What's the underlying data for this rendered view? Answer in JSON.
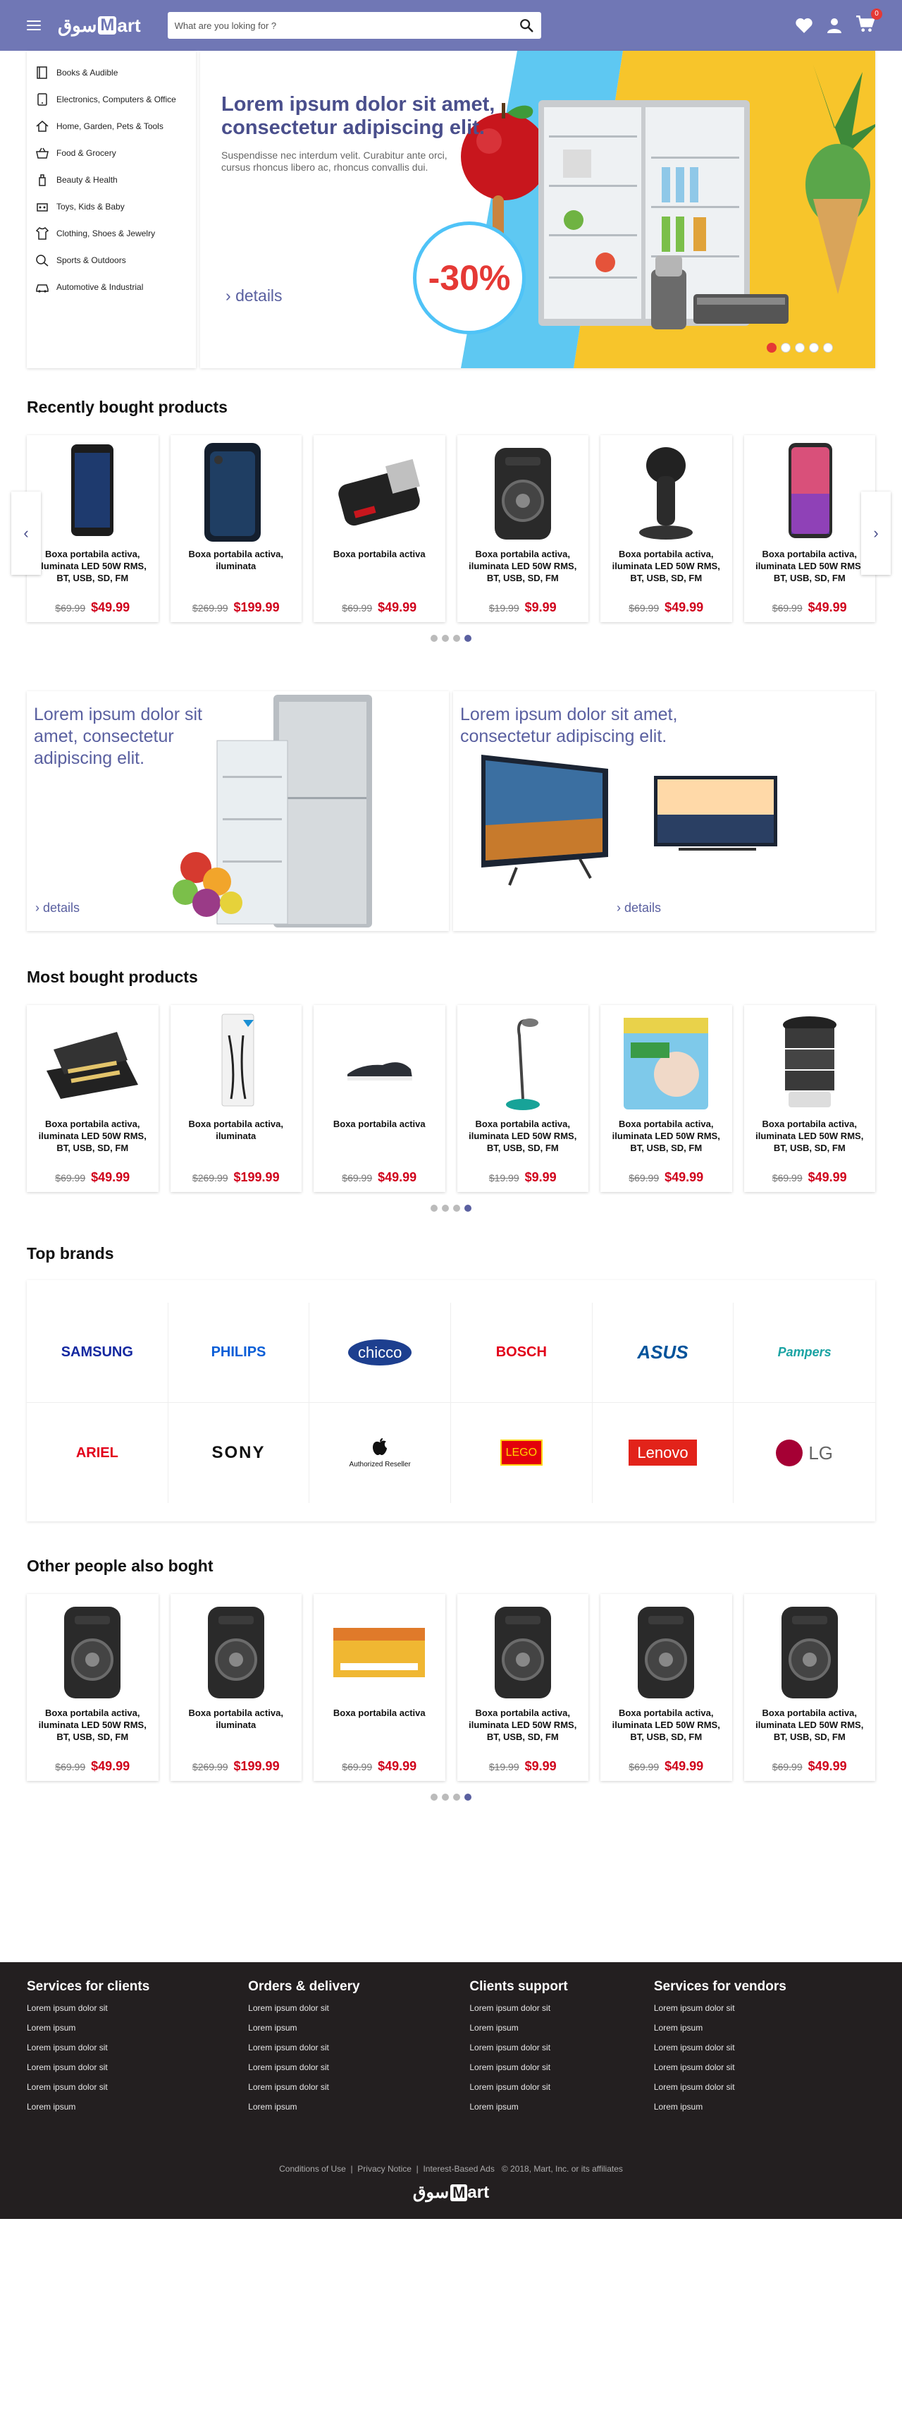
{
  "header": {
    "logo_arabic": "سوق",
    "logo_m": "M",
    "logo_rest": "art",
    "search_placeholder": "What are you loking for ?",
    "cart_count": "0"
  },
  "categories": [
    {
      "label": "Books & Audible",
      "icon": "book-icon"
    },
    {
      "label": "Electronics, Computers & Office",
      "icon": "tablet-icon"
    },
    {
      "label": "Home, Garden, Pets & Tools",
      "icon": "home-icon"
    },
    {
      "label": "Food & Grocery",
      "icon": "basket-icon"
    },
    {
      "label": "Beauty & Health",
      "icon": "beauty-icon"
    },
    {
      "label": "Toys, Kids & Baby",
      "icon": "toy-icon"
    },
    {
      "label": "Clothing, Shoes & Jewelry",
      "icon": "clothing-icon"
    },
    {
      "label": "Sports & Outdoors",
      "icon": "sports-icon"
    },
    {
      "label": "Automotive & Industrial",
      "icon": "car-icon"
    }
  ],
  "banner": {
    "title": "Lorem ipsum dolor sit amet, consectetur adipiscing elit.",
    "subtitle": "Suspendisse nec interdum velit. Curabitur ante orci, cursus rhoncus libero ac, rhoncus convallis dui.",
    "discount": "-30%",
    "details": "details",
    "slides": 5,
    "active_slide": 0
  },
  "sections": {
    "recent": "Recently bought products",
    "most": "Most bought products",
    "brands": "Top brands",
    "others": "Other people also boght"
  },
  "recent_products": [
    {
      "name": "Boxa portabila activa, iluminata LED 50W RMS, BT, USB, SD, FM",
      "old": "$69.99",
      "new": "$49.99",
      "icon": "phone-icon"
    },
    {
      "name": "Boxa portabila activa, iluminata",
      "old": "$269.99",
      "new": "$199.99",
      "icon": "phone-case-icon"
    },
    {
      "name": "Boxa portabila activa",
      "old": "$69.99",
      "new": "$49.99",
      "icon": "usb-drive-icon"
    },
    {
      "name": "Boxa portabila activa, iluminata LED 50W RMS, BT, USB, SD, FM",
      "old": "$19.99",
      "new": "$9.99",
      "icon": "speaker-icon"
    },
    {
      "name": "Boxa portabila activa, iluminata LED 50W RMS, BT, USB, SD, FM",
      "old": "$69.99",
      "new": "$49.99",
      "icon": "steamer-icon"
    },
    {
      "name": "Boxa portabila activa, iluminata LED 50W RMS, BT, USB, SD, FM",
      "old": "$69.99",
      "new": "$49.99",
      "icon": "smartphone-icon"
    }
  ],
  "promos": [
    {
      "text": "Lorem ipsum dolor sit amet, consectetur adipiscing elit.",
      "details": "details"
    },
    {
      "text": "Lorem ipsum dolor sit amet, consectetur adipiscing elit.",
      "details": "details"
    }
  ],
  "most_products": [
    {
      "name": "Boxa portabila activa, iluminata LED 50W RMS, BT, USB, SD, FM",
      "old": "$69.99",
      "new": "$49.99",
      "icon": "grill-icon"
    },
    {
      "name": "Boxa portabila activa, iluminata",
      "old": "$269.99",
      "new": "$199.99",
      "icon": "cable-icon"
    },
    {
      "name": "Boxa portabila activa",
      "old": "$69.99",
      "new": "$49.99",
      "icon": "shoe-icon"
    },
    {
      "name": "Boxa portabila activa, iluminata LED 50W RMS, BT, USB, SD, FM",
      "old": "$19.99",
      "new": "$9.99",
      "icon": "lamp-icon"
    },
    {
      "name": "Boxa portabila activa, iluminata LED 50W RMS, BT, USB, SD, FM",
      "old": "$69.99",
      "new": "$49.99",
      "icon": "diapers-icon"
    },
    {
      "name": "Boxa portabila activa, iluminata LED 50W RMS, BT, USB, SD, FM",
      "old": "$69.99",
      "new": "$49.99",
      "icon": "food-steamer-icon"
    }
  ],
  "brands": [
    {
      "name": "SAMSUNG",
      "color": "#1428a0"
    },
    {
      "name": "PHILIPS",
      "color": "#0b5ed7"
    },
    {
      "name": "chicco",
      "color": "#1d3f8f"
    },
    {
      "name": "BOSCH",
      "color": "#e2001a"
    },
    {
      "name": "ASUS",
      "color": "#00539b"
    },
    {
      "name": "Pampers",
      "color": "#1aa3a3"
    },
    {
      "name": "ARIEL",
      "color": "#e2001a"
    },
    {
      "name": "SONY",
      "color": "#111111"
    },
    {
      "name": "Authorized Reseller",
      "color": "#111111"
    },
    {
      "name": "LEGO",
      "color": "#e3000b"
    },
    {
      "name": "Lenovo",
      "color": "#e2231a"
    },
    {
      "name": "LG",
      "color": "#a50034"
    }
  ],
  "other_products": [
    {
      "name": "Boxa portabila activa, iluminata LED 50W RMS, BT, USB, SD, FM",
      "old": "$69.99",
      "new": "$49.99",
      "icon": "speaker-icon"
    },
    {
      "name": "Boxa portabila activa, iluminata",
      "old": "$269.99",
      "new": "$199.99",
      "icon": "speaker-icon"
    },
    {
      "name": "Boxa portabila activa",
      "old": "$69.99",
      "new": "$49.99",
      "icon": "voucher-icon"
    },
    {
      "name": "Boxa portabila activa, iluminata LED 50W RMS, BT, USB, SD, FM",
      "old": "$19.99",
      "new": "$9.99",
      "icon": "speaker-icon"
    },
    {
      "name": "Boxa portabila activa, iluminata LED 50W RMS, BT, USB, SD, FM",
      "old": "$69.99",
      "new": "$49.99",
      "icon": "speaker-icon"
    },
    {
      "name": "Boxa portabila activa, iluminata LED 50W RMS, BT, USB, SD, FM",
      "old": "$69.99",
      "new": "$49.99",
      "icon": "speaker-icon"
    }
  ],
  "footer": {
    "columns": [
      {
        "title": "Services for clients",
        "links": [
          "Lorem ipsum dolor sit",
          "Lorem ipsum",
          "Lorem ipsum dolor sit",
          "Lorem ipsum dolor sit",
          "Lorem ipsum dolor sit",
          "Lorem ipsum"
        ]
      },
      {
        "title": "Orders & delivery",
        "links": [
          "Lorem ipsum dolor sit",
          "Lorem ipsum",
          "Lorem ipsum dolor sit",
          "Lorem ipsum dolor sit",
          "Lorem ipsum dolor sit",
          "Lorem ipsum"
        ]
      },
      {
        "title": "Clients support",
        "links": [
          "Lorem ipsum dolor sit",
          "Lorem ipsum",
          "Lorem ipsum dolor sit",
          "Lorem ipsum dolor sit",
          "Lorem ipsum dolor sit",
          "Lorem ipsum"
        ]
      },
      {
        "title": "Services for vendors",
        "links": [
          "Lorem ipsum dolor sit",
          "Lorem ipsum",
          "Lorem ipsum dolor sit",
          "Lorem ipsum dolor sit",
          "Lorem ipsum dolor sit",
          "Lorem ipsum"
        ]
      }
    ],
    "legal_links": [
      "Conditions of Use",
      "Privacy Notice",
      "Interest-Based Ads"
    ],
    "copyright": "© 2018, Mart, Inc. or its affiliates"
  },
  "colors": {
    "brand": "#7077b5",
    "accent": "#5a60a0",
    "price": "#d0021b",
    "footer": "#231f20"
  }
}
